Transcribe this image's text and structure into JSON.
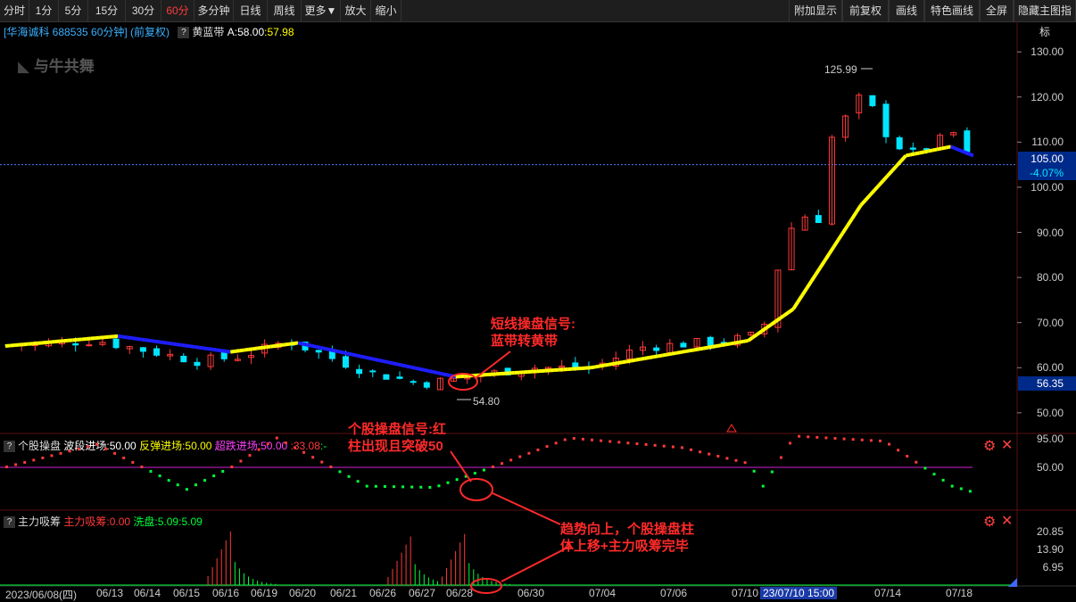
{
  "toolbar": {
    "left": [
      {
        "label": "分时",
        "active": false
      },
      {
        "label": "1分",
        "active": false
      },
      {
        "label": "5分",
        "active": false
      },
      {
        "label": "15分",
        "active": false
      },
      {
        "label": "30分",
        "active": false
      },
      {
        "label": "60分",
        "active": true
      },
      {
        "label": "多分钟",
        "active": false
      },
      {
        "label": "日线",
        "active": false
      },
      {
        "label": "周线",
        "active": false
      },
      {
        "label": "更多▼",
        "active": false
      },
      {
        "label": "放大",
        "active": false
      },
      {
        "label": "缩小",
        "active": false
      }
    ],
    "right": [
      "附加显示",
      "前复权",
      "画线",
      "特色画线",
      "全屏",
      "隐藏主图指标"
    ]
  },
  "main_header": {
    "stock": "[华海诚科 688535 60分钟] (前复权)",
    "indicator": "黄蓝带",
    "a_label": "A:58.00",
    "a_value": ":57.98",
    "watermark": "与牛共舞"
  },
  "price_axis": {
    "ticks": [
      "130.00",
      "120.00",
      "110.00",
      "100.00",
      "90.00",
      "80.00",
      "70.00",
      "60.00",
      "50.00"
    ],
    "current_price": "105.00",
    "change_pct": "-4.07%",
    "lower_price": "56.35",
    "high_label": "125.99",
    "low_label": "54.80"
  },
  "panel2": {
    "name": "个股操盘",
    "l1": "波段进场:50.00",
    "l2": "反弹进场:50.00",
    "l3": "超跌进场:50.00",
    "l4": ":33.08",
    "l5": ":-",
    "ticks": [
      "95.00",
      "50.00"
    ]
  },
  "panel3": {
    "name": "主力吸筹",
    "l1": "主力吸筹:0.00",
    "l2": "洗盘:5.09",
    "l3": ":5.09",
    "ticks": [
      "20.85",
      "13.90",
      "6.95"
    ]
  },
  "dates": [
    "2023/06/08(四)",
    "06/13",
    "06/14",
    "06/15",
    "06/16",
    "06/19",
    "06/20",
    "06/21",
    "06/26",
    "06/27",
    "06/28",
    "06/30",
    "07/04",
    "07/06",
    "07/10",
    "23/07/10 15:00",
    "07/14",
    "07/18"
  ],
  "annotations": {
    "a1_line1": "短线操盘信号:",
    "a1_line2": "蓝带转黄带",
    "a2_line1": "个股操盘信号:红",
    "a2_line2": "柱出现且突破50",
    "a3_line1": "趋势向上，个股操盘柱",
    "a3_line2": "体上移+主力吸筹完毕"
  },
  "colors": {
    "up": "#ff3a3a",
    "down": "#00e5ff",
    "yellow": "#ffff00",
    "blue": "#1e1eff",
    "accent": "#ff2a2a",
    "magenta": "#d020d0",
    "green": "#00ff3a"
  },
  "chart_data": {
    "type": "candlestick",
    "interval": "60min",
    "ylim": [
      48,
      133
    ],
    "close_points": [
      {
        "i": 0,
        "v": 65
      },
      {
        "i": 20,
        "v": 66
      },
      {
        "i": 42,
        "v": 61.5
      },
      {
        "i": 52,
        "v": 62.5
      },
      {
        "i": 62,
        "v": 66
      },
      {
        "i": 80,
        "v": 59
      },
      {
        "i": 92,
        "v": 56.5
      },
      {
        "i": 100,
        "v": 57.5
      },
      {
        "i": 115,
        "v": 60
      },
      {
        "i": 130,
        "v": 60
      },
      {
        "i": 140,
        "v": 64.5
      },
      {
        "i": 160,
        "v": 66
      },
      {
        "i": 165,
        "v": 67
      },
      {
        "i": 167,
        "v": 65
      },
      {
        "i": 170,
        "v": 79
      },
      {
        "i": 175,
        "v": 94
      },
      {
        "i": 180,
        "v": 93
      },
      {
        "i": 183,
        "v": 111
      },
      {
        "i": 190,
        "v": 121
      },
      {
        "i": 195,
        "v": 112
      },
      {
        "i": 200,
        "v": 107
      },
      {
        "i": 210,
        "v": 112
      },
      {
        "i": 215,
        "v": 104
      }
    ],
    "band_points": [
      {
        "i": 0,
        "v": 64.8
      },
      {
        "i": 25,
        "v": 67
      },
      {
        "i": 50,
        "v": 63.5
      },
      {
        "i": 65,
        "v": 65.5
      },
      {
        "i": 100,
        "v": 58
      },
      {
        "i": 130,
        "v": 60
      },
      {
        "i": 165,
        "v": 66
      },
      {
        "i": 175,
        "v": 73
      },
      {
        "i": 190,
        "v": 96
      },
      {
        "i": 200,
        "v": 107
      },
      {
        "i": 210,
        "v": 109
      },
      {
        "i": 215,
        "v": 107
      }
    ],
    "high": 125.99,
    "low": 54.8
  }
}
